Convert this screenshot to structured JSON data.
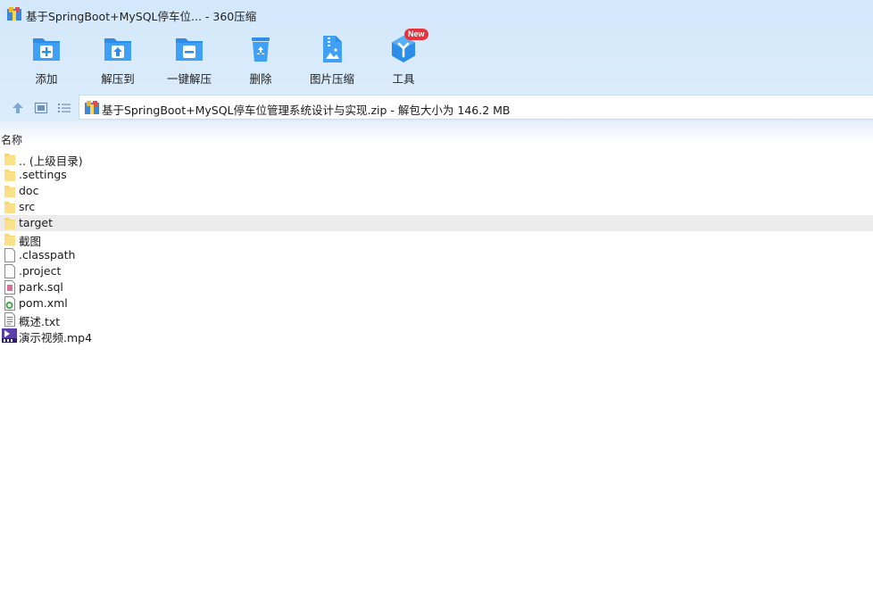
{
  "window": {
    "title": "基于SpringBoot+MySQL停车位... - 360压缩"
  },
  "toolbar": {
    "add_label": "添加",
    "extract_to_label": "解压到",
    "one_click_extract_label": "一键解压",
    "delete_label": "删除",
    "image_compress_label": "图片压缩",
    "tools_label": "工具",
    "tools_badge": "New"
  },
  "address": {
    "path_text": "基于SpringBoot+MySQL停车位管理系统设计与实现.zip - 解包大小为 146.2 MB"
  },
  "list": {
    "column_name": "名称",
    "items": [
      {
        "name": ".. (上级目录)",
        "icon": "folder-icon"
      },
      {
        "name": ".settings",
        "icon": "folder-icon"
      },
      {
        "name": "doc",
        "icon": "folder-icon"
      },
      {
        "name": "src",
        "icon": "folder-icon"
      },
      {
        "name": "target",
        "icon": "folder-icon",
        "selected": true
      },
      {
        "name": "截图",
        "icon": "folder-icon"
      },
      {
        "name": ".classpath",
        "icon": "file-icon"
      },
      {
        "name": ".project",
        "icon": "file-icon"
      },
      {
        "name": "park.sql",
        "icon": "sql-file-icon"
      },
      {
        "name": "pom.xml",
        "icon": "xml-file-icon"
      },
      {
        "name": "概述.txt",
        "icon": "text-file-icon"
      },
      {
        "name": "演示视频.mp4",
        "icon": "video-file-icon"
      }
    ]
  },
  "colors": {
    "accent": "#2b8ee8",
    "folder": "#f7d774",
    "badge": "#e8323c",
    "selected_row": "#ececec"
  }
}
